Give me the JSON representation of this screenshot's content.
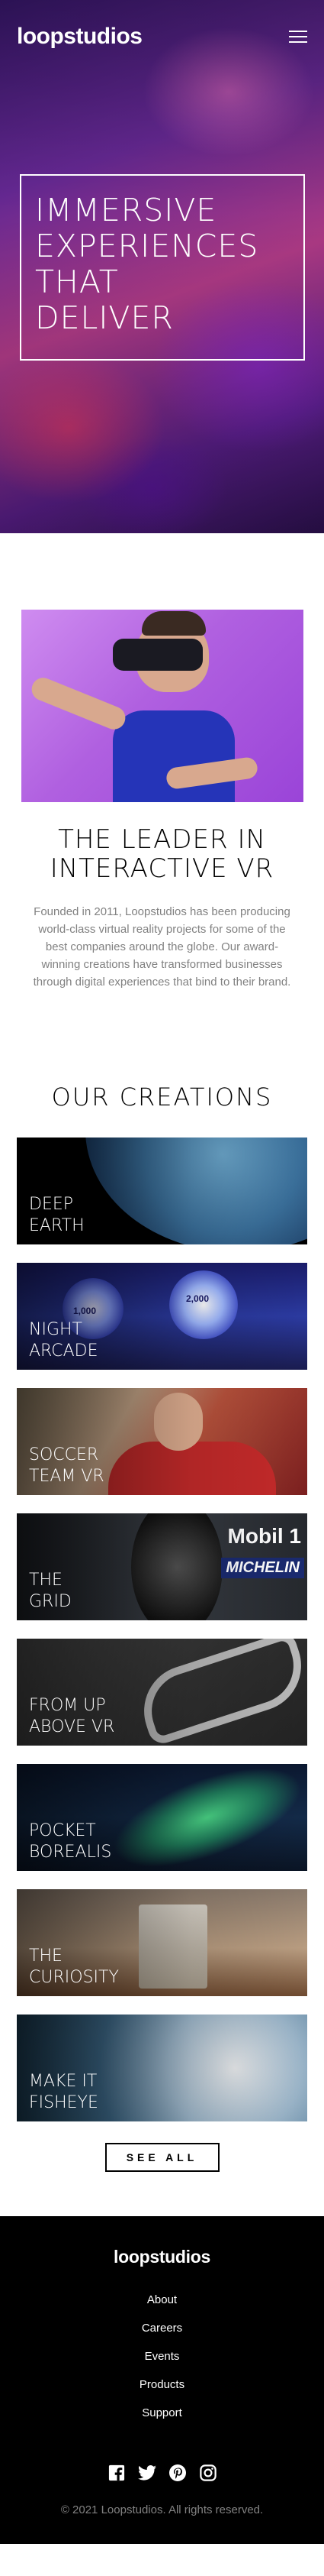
{
  "brand": {
    "name": "loopstudios"
  },
  "hero": {
    "title": "Immersive\nexperiences\nthat\ndeliver"
  },
  "intro": {
    "title": "The leader in\ninteractive VR",
    "text": "Founded in 2011, Loopstudios has been producing world-class virtual reality projects for some of the best companies around the globe. Our award-winning creations have transformed businesses through digital experiences that bind to their brand."
  },
  "creations": {
    "title": "Our creations",
    "items": [
      {
        "label": "Deep\nearth"
      },
      {
        "label": "Night\narcade"
      },
      {
        "label": "Soccer\nteam VR"
      },
      {
        "label": "The\ngrid"
      },
      {
        "label": "From up\nabove VR"
      },
      {
        "label": "Pocket\nborealis"
      },
      {
        "label": "The\ncuriosity"
      },
      {
        "label": "Make it\nfisheye"
      }
    ],
    "see_all": "See all"
  },
  "arcade_text": {
    "score1": "1,000",
    "score2": "2,000"
  },
  "grid_text": {
    "mobil": "Mobil 1",
    "michelin": "MICHELIN"
  },
  "footer": {
    "logo": "loopstudios",
    "nav": [
      "About",
      "Careers",
      "Events",
      "Products",
      "Support"
    ],
    "socials": [
      "facebook-icon",
      "twitter-icon",
      "pinterest-icon",
      "instagram-icon"
    ],
    "copyright": "© 2021 Loopstudios. All rights reserved."
  },
  "colors": {
    "text_gray": "#818181",
    "black": "#000000",
    "white": "#ffffff"
  }
}
